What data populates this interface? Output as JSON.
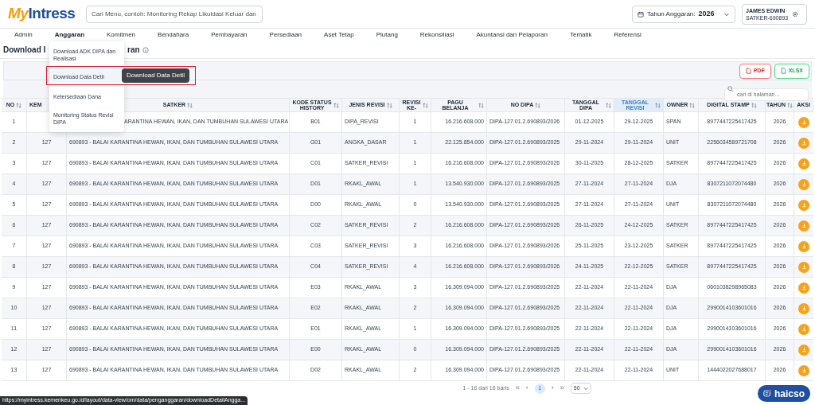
{
  "header": {
    "logo_a": "My",
    "logo_b": "Intress",
    "search": {
      "placeholder": "Cari Menu, contoh: Monitoring Rekap Likuidasi Keluar dan"
    },
    "year_label": "Tahun Anggaran:",
    "year": "2026",
    "user_name": "JAMES EDWIN",
    "user_unit": "SATKER-690893"
  },
  "menu": [
    {
      "label": "Admin",
      "selected": false
    },
    {
      "label": "Anggaran",
      "selected": true
    },
    {
      "label": "Komitmen",
      "selected": false
    },
    {
      "label": "Bendahara",
      "selected": false
    },
    {
      "label": "Pembayaran",
      "selected": false
    },
    {
      "label": "Persediaan",
      "selected": false
    },
    {
      "label": "Aset Tetap",
      "selected": false
    },
    {
      "label": "Piutang",
      "selected": false
    },
    {
      "label": "Rekonsiliasi",
      "selected": false
    },
    {
      "label": "Akuntansi dan Pelaporan",
      "selected": false
    },
    {
      "label": "Tematik",
      "selected": false
    },
    {
      "label": "Referensi",
      "selected": false
    }
  ],
  "dropdown": [
    {
      "label": "Download ADK DIPA dan Realisasi",
      "highlighted": false
    },
    {
      "label": "Download Data Detil",
      "highlighted": true
    },
    {
      "label": "Ketersediaan Dana",
      "highlighted": false
    },
    {
      "label": "Monitoring Status Revisi DIPA",
      "highlighted": false
    }
  ],
  "tooltip": "Download Data Detil",
  "title_start": "Download I",
  "title_end": "ran",
  "export_buttons": [
    {
      "kind": "pdf",
      "label": "PDF"
    },
    {
      "kind": "xlsx",
      "label": "XLSX"
    }
  ],
  "page_search": {
    "placeholder": "cari di halaman..."
  },
  "columns": [
    {
      "label": "NO",
      "sortable": true,
      "selected": false
    },
    {
      "label": "KEM",
      "sortable": false,
      "selected": false
    },
    {
      "label": "SATKER",
      "sortable": true,
      "selected": false
    },
    {
      "label": "KODE STATUS HISTORY",
      "sortable": true,
      "selected": false
    },
    {
      "label": "JENIS REVISI",
      "sortable": true,
      "selected": false
    },
    {
      "label": "REVISI KE-",
      "sortable": true,
      "selected": false
    },
    {
      "label": "PAGU BELANJA",
      "sortable": true,
      "selected": false
    },
    {
      "label": "NO DIPA",
      "sortable": true,
      "selected": false
    },
    {
      "label": "TANGGAL DIPA",
      "sortable": true,
      "selected": false
    },
    {
      "label": "TANGGAL REVISI",
      "sortable": true,
      "selected": true
    },
    {
      "label": "OWNER",
      "sortable": true,
      "selected": false
    },
    {
      "label": "DIGITAL STAMP",
      "sortable": true,
      "selected": false
    },
    {
      "label": "TAHUN",
      "sortable": true,
      "selected": false
    },
    {
      "label": "AKSI",
      "sortable": false,
      "selected": false
    }
  ],
  "rows": [
    {
      "no": "1",
      "satker": "ARANTINA HEWAN, IKAN, DAN TUMBUHAN SULAWESI UTARA",
      "under_menu": true,
      "kode": "B01",
      "jenis": "DIPA_REVISI",
      "revisi": "1",
      "pagu": "16.216.608.000",
      "dipa": "DIPA-127.01.2.690893/2026",
      "tgl_dipa": "01-12-2025",
      "tgl_revisi": "29-12-2025",
      "owner": "SPAN",
      "stamp": "8977447225417425",
      "tahun": "2026"
    },
    {
      "no": "2",
      "kem": "127",
      "satker": "690893 - BALAI KARANTINA HEWAN, IKAN, DAN TUMBUHAN SULAWESI UTARA",
      "under_menu": false,
      "kode": "G01",
      "jenis": "ANGKA_DASAR",
      "revisi": "1",
      "pagu": "22.125.854.000",
      "dipa": "DIPA-127.01.2.690893/2025",
      "tgl_dipa": "29-11-2024",
      "tgl_revisi": "29-11-2024",
      "owner": "UNIT",
      "stamp": "2256034589721708",
      "tahun": "2026"
    },
    {
      "no": "3",
      "kem": "127",
      "satker": "690893 - BALAI KARANTINA HEWAN, IKAN, DAN TUMBUHAN SULAWESI UTARA",
      "under_menu": false,
      "kode": "C01",
      "jenis": "SATKER_REVISI",
      "revisi": "1",
      "pagu": "16.216.608.000",
      "dipa": "DIPA-127.01.2.690893/2026",
      "tgl_dipa": "30-11-2025",
      "tgl_revisi": "28-12-2025",
      "owner": "SATKER",
      "stamp": "8977447225417425",
      "tahun": "2026"
    },
    {
      "no": "4",
      "kem": "127",
      "satker": "690893 - BALAI KARANTINA HEWAN, IKAN, DAN TUMBUHAN SULAWESI UTARA",
      "under_menu": false,
      "kode": "D01",
      "jenis": "RKAKL_AWAL",
      "revisi": "1",
      "pagu": "13.540.930.000",
      "dipa": "DIPA-127.01.2.690893/2025",
      "tgl_dipa": "27-11-2024",
      "tgl_revisi": "27-11-2024",
      "owner": "DJA",
      "stamp": "8307211072074480",
      "tahun": "2026"
    },
    {
      "no": "5",
      "kem": "127",
      "satker": "690893 - BALAI KARANTINA HEWAN, IKAN, DAN TUMBUHAN SULAWESI UTARA",
      "under_menu": false,
      "kode": "D00",
      "jenis": "RKAKL_AWAL",
      "revisi": "0",
      "pagu": "13.540.930.000",
      "dipa": "DIPA-127.01.2.690893/2025",
      "tgl_dipa": "27-11-2024",
      "tgl_revisi": "27-11-2024",
      "owner": "UNIT",
      "stamp": "8307211072074480",
      "tahun": "2026"
    },
    {
      "no": "6",
      "kem": "127",
      "satker": "690893 - BALAI KARANTINA HEWAN, IKAN, DAN TUMBUHAN SULAWESI UTARA",
      "under_menu": false,
      "kode": "C02",
      "jenis": "SATKER_REVISI",
      "revisi": "2",
      "pagu": "16.216.608.000",
      "dipa": "DIPA-127.01.2.690893/2026",
      "tgl_dipa": "26-11-2025",
      "tgl_revisi": "24-12-2025",
      "owner": "SATKER",
      "stamp": "8977447225417425",
      "tahun": "2026"
    },
    {
      "no": "7",
      "kem": "127",
      "satker": "690893 - BALAI KARANTINA HEWAN, IKAN, DAN TUMBUHAN SULAWESI UTARA",
      "under_menu": false,
      "kode": "C03",
      "jenis": "SATKER_REVISI",
      "revisi": "3",
      "pagu": "16.216.608.000",
      "dipa": "DIPA-127.01.2.690893/2026",
      "tgl_dipa": "25-11-2025",
      "tgl_revisi": "23-12-2025",
      "owner": "SATKER",
      "stamp": "8977447225417425",
      "tahun": "2026"
    },
    {
      "no": "8",
      "kem": "127",
      "satker": "690893 - BALAI KARANTINA HEWAN, IKAN, DAN TUMBUHAN SULAWESI UTARA",
      "under_menu": false,
      "kode": "C04",
      "jenis": "SATKER_REVISI",
      "revisi": "4",
      "pagu": "16.216.608.000",
      "dipa": "DIPA-127.01.2.690893/2026",
      "tgl_dipa": "24-11-2025",
      "tgl_revisi": "22-12-2025",
      "owner": "SATKER",
      "stamp": "8977447225417425",
      "tahun": "2026"
    },
    {
      "no": "9",
      "kem": "127",
      "satker": "690893 - BALAI KARANTINA HEWAN, IKAN, DAN TUMBUHAN SULAWESI UTARA",
      "under_menu": false,
      "kode": "E03",
      "jenis": "RKAKL_AWAL",
      "revisi": "3",
      "pagu": "16.309.094.000",
      "dipa": "DIPA-127.01.2.690893/2025",
      "tgl_dipa": "22-11-2024",
      "tgl_revisi": "22-11-2024",
      "owner": "DJA",
      "stamp": "0601038298965083",
      "tahun": "2026"
    },
    {
      "no": "10",
      "kem": "127",
      "satker": "690893 - BALAI KARANTINA HEWAN, IKAN, DAN TUMBUHAN SULAWESI UTARA",
      "under_menu": false,
      "kode": "E02",
      "jenis": "RKAKL_AWAL",
      "revisi": "2",
      "pagu": "16.309.094.000",
      "dipa": "DIPA-127.01.2.690893/2025",
      "tgl_dipa": "22-11-2024",
      "tgl_revisi": "22-11-2024",
      "owner": "DJA",
      "stamp": "2990014103601016",
      "tahun": "2026"
    },
    {
      "no": "11",
      "kem": "127",
      "satker": "690893 - BALAI KARANTINA HEWAN, IKAN, DAN TUMBUHAN SULAWESI UTARA",
      "under_menu": false,
      "kode": "E01",
      "jenis": "RKAKL_AWAL",
      "revisi": "1",
      "pagu": "16.309.094.000",
      "dipa": "DIPA-127.01.2.690893/2025",
      "tgl_dipa": "22-11-2024",
      "tgl_revisi": "22-11-2024",
      "owner": "DJA",
      "stamp": "2990014103601016",
      "tahun": "2026"
    },
    {
      "no": "12",
      "kem": "127",
      "satker": "690893 - BALAI KARANTINA HEWAN, IKAN, DAN TUMBUHAN SULAWESI UTARA",
      "under_menu": false,
      "kode": "E00",
      "jenis": "RKAKL_AWAL",
      "revisi": "0",
      "pagu": "16.309.094.000",
      "dipa": "DIPA-127.01.2.690893/2025",
      "tgl_dipa": "22-11-2024",
      "tgl_revisi": "22-11-2024",
      "owner": "DJA",
      "stamp": "2990014103601016",
      "tahun": "2026"
    },
    {
      "no": "13",
      "kem": "127",
      "satker": "690893 - BALAI KARANTINA HEWAN, IKAN, DAN TUMBUHAN SULAWESI UTARA",
      "under_menu": false,
      "kode": "D02",
      "jenis": "RKAKL_AWAL",
      "revisi": "2",
      "pagu": "16.309.094.000",
      "dipa": "DIPA-127.01.2.690893/2025",
      "tgl_dipa": "22-11-2024",
      "tgl_revisi": "22-11-2024",
      "owner": "UNIT",
      "stamp": "1444022027688017",
      "tahun": "2026"
    }
  ],
  "pagination": {
    "summary": "1 - 16 dari 16 baris",
    "first": "«",
    "prev": "‹",
    "pages": [
      {
        "label": "1",
        "selected": true
      }
    ],
    "next": "›",
    "last": "»",
    "page_size": "50"
  },
  "status_url": "https://myintress.kemenkeu.go.id/layout/data-view/om/data/penganggaran/downloadDetailAngga...",
  "chat": {
    "label": "haicso"
  }
}
